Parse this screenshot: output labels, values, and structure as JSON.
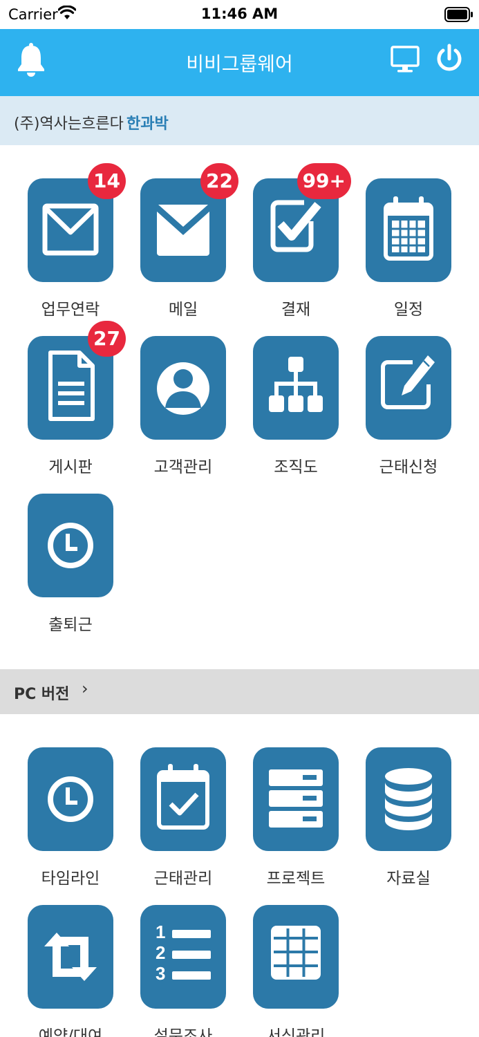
{
  "status": {
    "carrier": "Carrier",
    "time": "11:46 AM"
  },
  "header": {
    "title": "비비그룹웨어"
  },
  "user": {
    "company": "(주)역사는흐른다",
    "name": "한과박"
  },
  "main_tiles": [
    {
      "label": "업무연락",
      "badge": "14"
    },
    {
      "label": "메일",
      "badge": "22"
    },
    {
      "label": "결재",
      "badge": "99+"
    },
    {
      "label": "일정"
    },
    {
      "label": "게시판",
      "badge": "27"
    },
    {
      "label": "고객관리"
    },
    {
      "label": "조직도"
    },
    {
      "label": "근태신청"
    },
    {
      "label": "출퇴근"
    }
  ],
  "pc": {
    "label": "PC 버전",
    "chevron": "›"
  },
  "pc_tiles": [
    {
      "label": "타임라인"
    },
    {
      "label": "근태관리"
    },
    {
      "label": "프로젝트"
    },
    {
      "label": "자료실"
    },
    {
      "label": "예약/대여"
    },
    {
      "label": "설문조사"
    },
    {
      "label": "서식관리"
    }
  ],
  "colors": {
    "header": "#2eb2ef",
    "tile": "#2c79a8",
    "badge": "#e8283e",
    "user_bar": "#dbeaf4",
    "pc_bar": "#dcdcdc"
  }
}
